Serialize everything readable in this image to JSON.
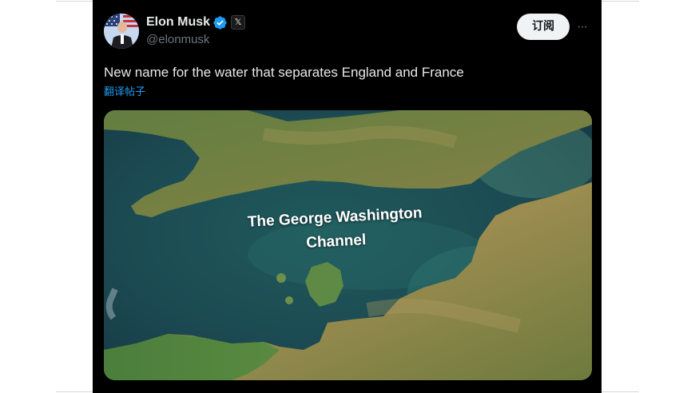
{
  "post": {
    "author_name": "Elon Musk",
    "author_handle": "@elonmusk",
    "subscribe_label": "订阅",
    "more_label": "···",
    "x_badge_label": "𝕏",
    "text": "New name for the water that separates England and France",
    "translate_label": "翻译帖子",
    "icons": [
      "verified-badge-icon",
      "x-logo-icon",
      "more-icon"
    ]
  },
  "media": {
    "caption_line1": "The George Washington",
    "caption_line2": "Channel"
  },
  "colors": {
    "background": "#000000",
    "text": "#e7e9ea",
    "secondary_text": "#71767b",
    "link": "#1d9bf0",
    "verified": "#1d9bf0"
  }
}
